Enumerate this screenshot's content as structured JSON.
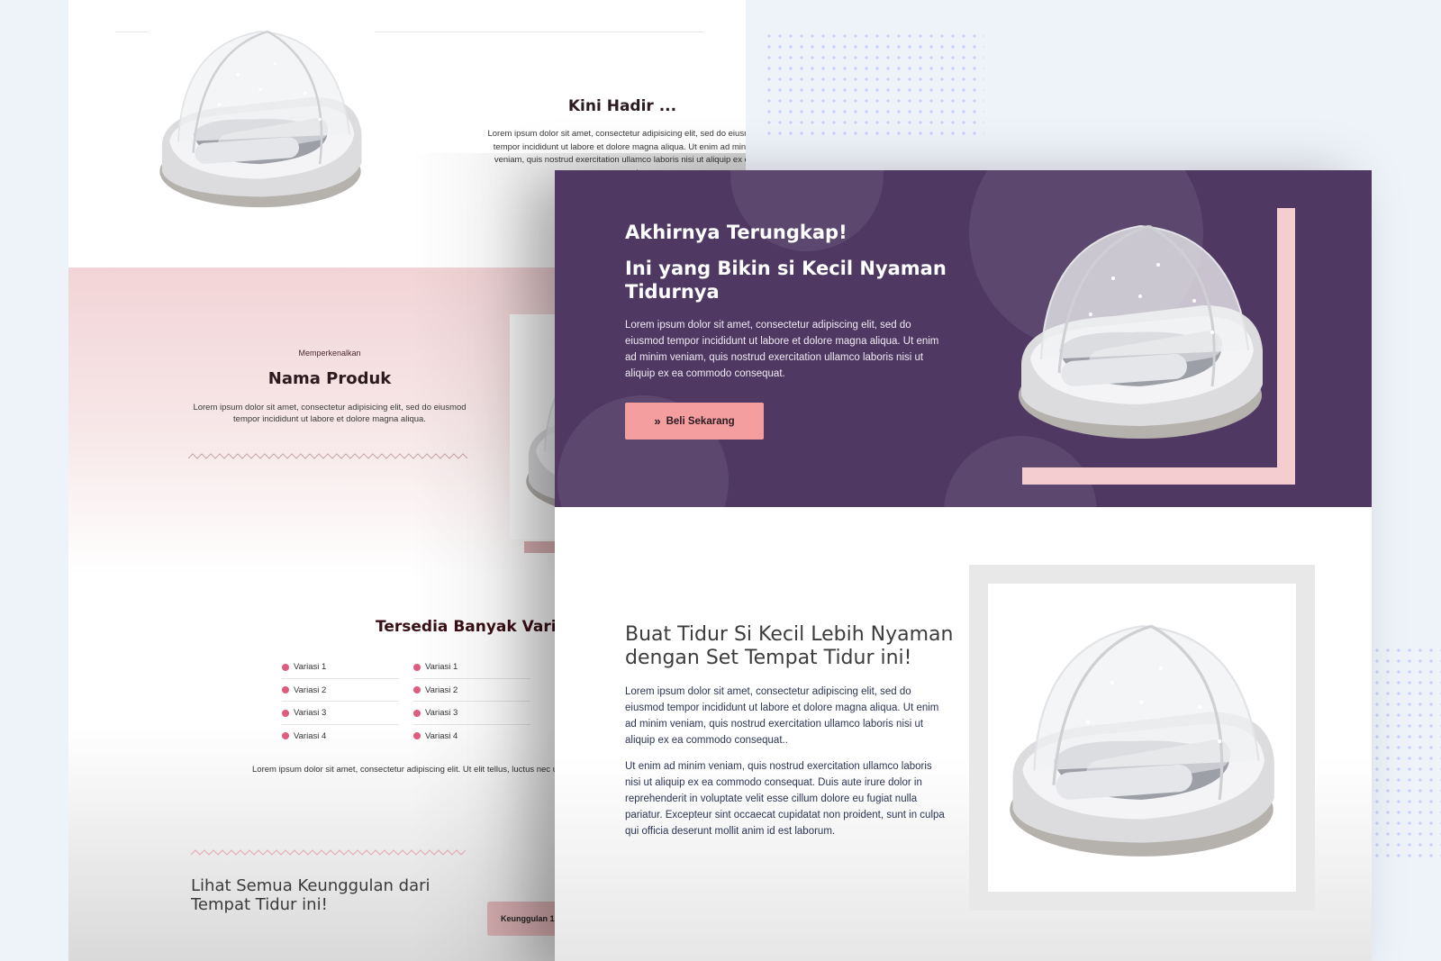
{
  "colors": {
    "purple": "#4f3862",
    "pink": "#f49ea0",
    "pink_light": "#f3cdd0",
    "bullet": "#e05c7e",
    "background": "#eef2f9"
  },
  "back_page": {
    "kini": {
      "title": "Kini Hadir ...",
      "text": "Lorem ipsum dolor sit amet, consectetur adipisicing elit, sed do eiusmod tempor incididunt ut labore et dolore magna aliqua. Ut enim ad minim veniam, quis nostrud exercitation ullamco laboris nisi ut aliquip ex ea commodo"
    },
    "intro": {
      "eyebrow": "Memperkenalkan",
      "title": "Nama Produk",
      "text": "Lorem ipsum dolor sit amet, consectetur adipisicing elit, sed do eiusmod tempor incididunt ut labore et dolore magna aliqua."
    },
    "variants": {
      "title": "Tersedia Banyak Variasi",
      "left": [
        "Variasi 1",
        "Variasi 2",
        "Variasi 3",
        "Variasi 4"
      ],
      "right": [
        "Variasi 1",
        "Variasi 2",
        "Variasi 3",
        "Variasi 4"
      ],
      "note": "Lorem ipsum dolor sit amet, consectetur adipiscing elit. Ut elit tellus, luctus nec ullamcorper mattis,"
    },
    "advantages": {
      "title": "Lihat Semua Keunggulan dari Tempat Tidur ini!",
      "tab_label": "Keunggulan 1"
    }
  },
  "front_page": {
    "hero": {
      "title1": "Akhirnya Terungkap!",
      "title2": "Ini yang Bikin si Kecil Nyaman Tidurnya",
      "text": "Lorem ipsum dolor sit amet, consectetur adipiscing elit, sed do eiusmod tempor incididunt ut labore et dolore magna aliqua. Ut enim ad minim veniam, quis nostrud exercitation ullamco laboris nisi ut aliquip ex ea commodo consequat.",
      "button_label": "Beli Sekarang",
      "button_icon": "double-chevron-right-icon"
    },
    "info": {
      "title": "Buat Tidur Si Kecil Lebih Nyaman dengan Set Tempat Tidur ini!",
      "p1": "Lorem ipsum dolor sit amet, consectetur adipiscing elit, sed do eiusmod tempor incididunt ut labore et dolore magna aliqua. Ut enim ad minim veniam, quis nostrud exercitation ullamco laboris nisi ut aliquip ex ea commodo consequat..",
      "p2": "Ut enim ad minim veniam, quis nostrud exercitation ullamco laboris nisi ut aliquip ex ea commodo consequat. Duis aute irure dolor in reprehenderit in voluptate velit esse cillum dolore eu fugiat nulla pariatur. Excepteur sint occaecat cupidatat non proident, sunt in culpa qui officia deserunt mollit anim id est laborum."
    }
  }
}
